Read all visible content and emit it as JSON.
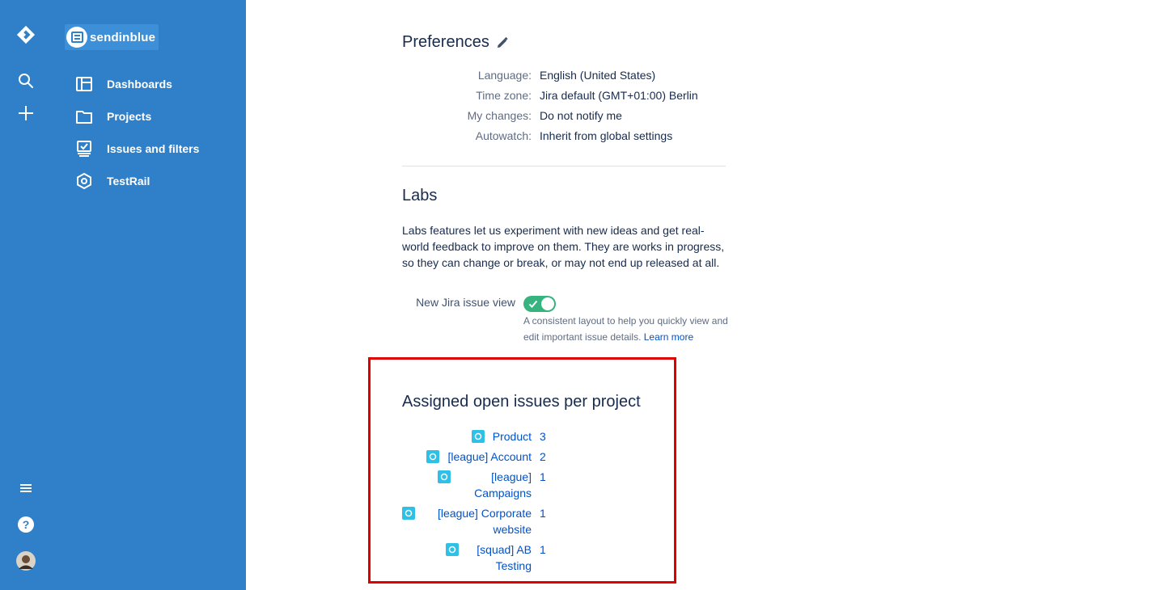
{
  "brand": {
    "name": "sendinblue"
  },
  "rail": {
    "icons": [
      "jira-logo-icon",
      "search-icon",
      "create-plus-icon",
      "menu-icon",
      "help-icon",
      "user-avatar"
    ]
  },
  "sidebar": {
    "items": [
      {
        "label": "Dashboards",
        "icon": "dashboard-icon"
      },
      {
        "label": "Projects",
        "icon": "folder-icon"
      },
      {
        "label": "Issues and filters",
        "icon": "issues-icon"
      },
      {
        "label": "TestRail",
        "icon": "testrail-icon"
      }
    ]
  },
  "preferences": {
    "title": "Preferences",
    "rows": [
      {
        "key": "Language:",
        "value": "English (United States)"
      },
      {
        "key": "Time zone:",
        "value": "Jira default (GMT+01:00) Berlin"
      },
      {
        "key": "My changes:",
        "value": "Do not notify me"
      },
      {
        "key": "Autowatch:",
        "value": "Inherit from global settings"
      }
    ]
  },
  "labs": {
    "title": "Labs",
    "description": "Labs features let us experiment with new ideas and get real-world feedback to improve on them. They are works in progress, so they can change or break, or may not end up released at all.",
    "option_label": "New Jira issue view",
    "option_enabled": true,
    "help_text": "A consistent layout to help you quickly view and edit important issue details.",
    "learn_more": "Learn more"
  },
  "assigned": {
    "title": "Assigned open issues per project",
    "projects": [
      {
        "name": "Product",
        "count": "3"
      },
      {
        "name": "[league] Account",
        "count": "2"
      },
      {
        "name": "[league] Campaigns",
        "count": "1"
      },
      {
        "name": "[league] Corporate website",
        "count": "1"
      },
      {
        "name": "[squad] AB Testing",
        "count": "1"
      }
    ]
  },
  "colors": {
    "sidebar": "#2f80c9",
    "toggle_on": "#36b37e",
    "link": "#0052cc",
    "highlight": "#e00000"
  }
}
